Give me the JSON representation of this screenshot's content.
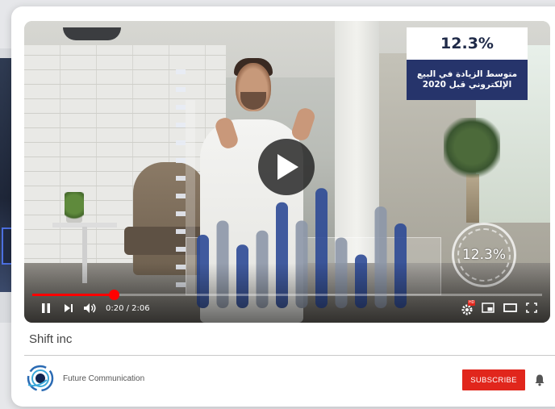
{
  "video": {
    "overlay_stat_value": "12.3%",
    "overlay_stat_caption_line1": "متوسط الزيادة في البيع",
    "overlay_stat_caption_line2": "الإلكتروني قبل 2020",
    "ring_value": "12.3%",
    "bar_values": [
      0.52,
      0.62,
      0.45,
      0.55,
      0.75,
      0.62,
      0.85,
      0.5,
      0.38,
      0.72,
      0.6
    ],
    "bar_colors": [
      "#2e4a96",
      "#8d97a8"
    ],
    "time_display": "0:20 / 2:06",
    "progress_fraction": 0.16,
    "progress_color": "#ff0000",
    "play_icon": "play-icon"
  },
  "controls": {
    "pause_icon": "pause-icon",
    "next_icon": "skip-next-icon",
    "volume_icon": "volume-icon",
    "settings_icon": "gear-icon",
    "settings_badge": "HD",
    "miniplayer_icon": "miniplayer-icon",
    "theater_icon": "theater-mode-icon",
    "fullscreen_icon": "fullscreen-icon"
  },
  "caption": "Shift inc",
  "channel": {
    "name": "Future Communication",
    "subscribe_label": "SUBSCRIBE",
    "accent_color": "#e1261c",
    "bell_icon": "bell-icon"
  }
}
